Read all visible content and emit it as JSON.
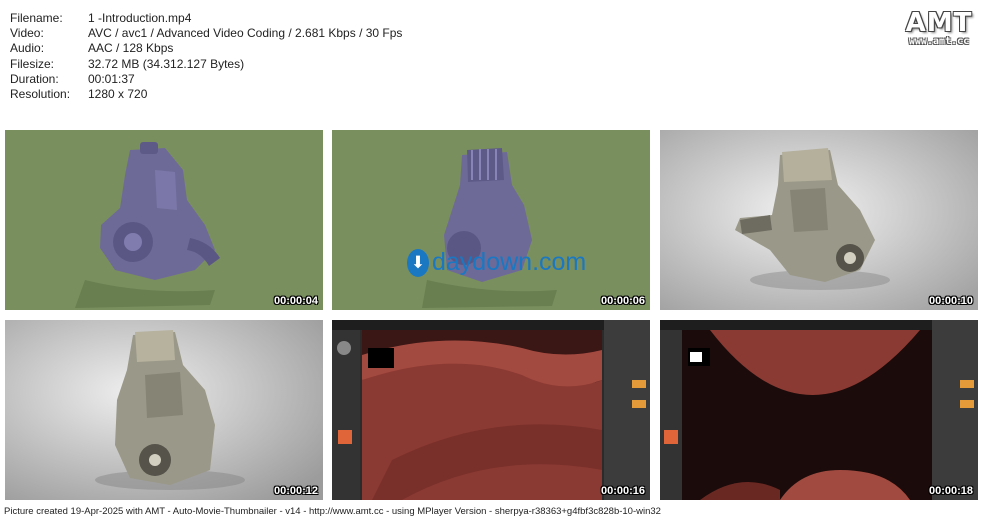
{
  "info": {
    "rows": [
      {
        "label": "Filename:",
        "value": "1 -Introduction.mp4"
      },
      {
        "label": "Video:",
        "value": "AVC / avc1 / Advanced Video Coding / 2.681 Kbps / 30 Fps"
      },
      {
        "label": "Audio:",
        "value": "AAC / 128 Kbps"
      },
      {
        "label": "Filesize:",
        "value": "32.72 MB (34.312.127 Bytes)"
      },
      {
        "label": "Duration:",
        "value": "00:01:37"
      },
      {
        "label": "Resolution:",
        "value": "1280 x 720"
      }
    ]
  },
  "logo": {
    "main": "AMT",
    "sub": "www.amt.cc"
  },
  "thumbnails": [
    {
      "timestamp": "00:00:04",
      "scene": "engine-purple-green-bg"
    },
    {
      "timestamp": "00:00:06",
      "scene": "engine-purple-green-bg-watermark",
      "watermark": "daydown.com"
    },
    {
      "timestamp": "00:00:10",
      "scene": "engine-textured-grey-bg"
    },
    {
      "timestamp": "00:00:12",
      "scene": "engine-textured-grey-bg"
    },
    {
      "timestamp": "00:00:16",
      "scene": "zbrush-red-surface"
    },
    {
      "timestamp": "00:00:18",
      "scene": "zbrush-red-surface"
    }
  ],
  "colors": {
    "green_bg": "#7a8f5e",
    "purple_model": "#6e6a98",
    "red_surface": "#8b3a33",
    "watermark_blue": "#1a78c2"
  },
  "footer": "Picture created 19-Apr-2025 with AMT - Auto-Movie-Thumbnailer - v14 - http://www.amt.cc - using MPlayer Version - sherpya-r38363+g4fbf3c828b-10-win32"
}
